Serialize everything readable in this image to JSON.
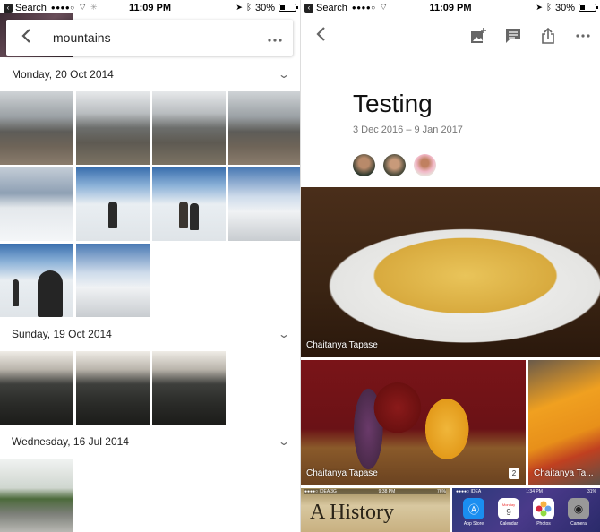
{
  "left_screen": {
    "status_bar": {
      "back_app": "Search",
      "signal": "●●●●○",
      "time": "11:09 PM",
      "battery_percent": "30%",
      "battery_level": 0.3
    },
    "search_bar": {
      "query": "mountains",
      "back_icon": "chevron-left-icon",
      "more_icon": "more-horizontal-icon"
    },
    "sections": [
      {
        "date": "Monday, 20 Oct 2014",
        "photo_count": 10
      },
      {
        "date": "Sunday, 19 Oct 2014",
        "photo_count": 3
      },
      {
        "date": "Wednesday, 16 Jul 2014",
        "photo_count": 1
      }
    ]
  },
  "right_screen": {
    "status_bar": {
      "back_app": "Search",
      "signal": "●●●●○",
      "time": "11:09 PM",
      "battery_percent": "30%",
      "battery_level": 0.3
    },
    "toolbar": {
      "back_icon": "chevron-left-icon",
      "actions": [
        "add-photo-icon",
        "comment-icon",
        "share-icon",
        "more-horizontal-icon"
      ]
    },
    "album": {
      "title": "Testing",
      "dates": "3 Dec 2016 – 9 Jan 2017",
      "contributors": [
        "contributor-1",
        "contributor-2",
        "contributor-3"
      ]
    },
    "photos": [
      {
        "kind": "fries",
        "caption": "Chaitanya Tapase"
      },
      {
        "kind": "drinks",
        "caption": "Chaitanya Tapase",
        "count": "2"
      },
      {
        "kind": "cup",
        "caption": "Chaitanya Ta..."
      },
      {
        "kind": "book-screenshot",
        "book_text": "A History",
        "mini_status": {
          "carrier": "●●●●○ IDEA 3G",
          "time": "9:38 PM",
          "battery": "76%"
        }
      },
      {
        "kind": "homescreen-screenshot",
        "mini_status": {
          "carrier": "●●●●○ IDEA",
          "time": "1:34 PM",
          "battery": "31%"
        },
        "apps": [
          "App Store",
          "Calendar",
          "Photos",
          "Camera"
        ],
        "calendar_day": "Monday",
        "calendar_date": "9"
      }
    ]
  }
}
